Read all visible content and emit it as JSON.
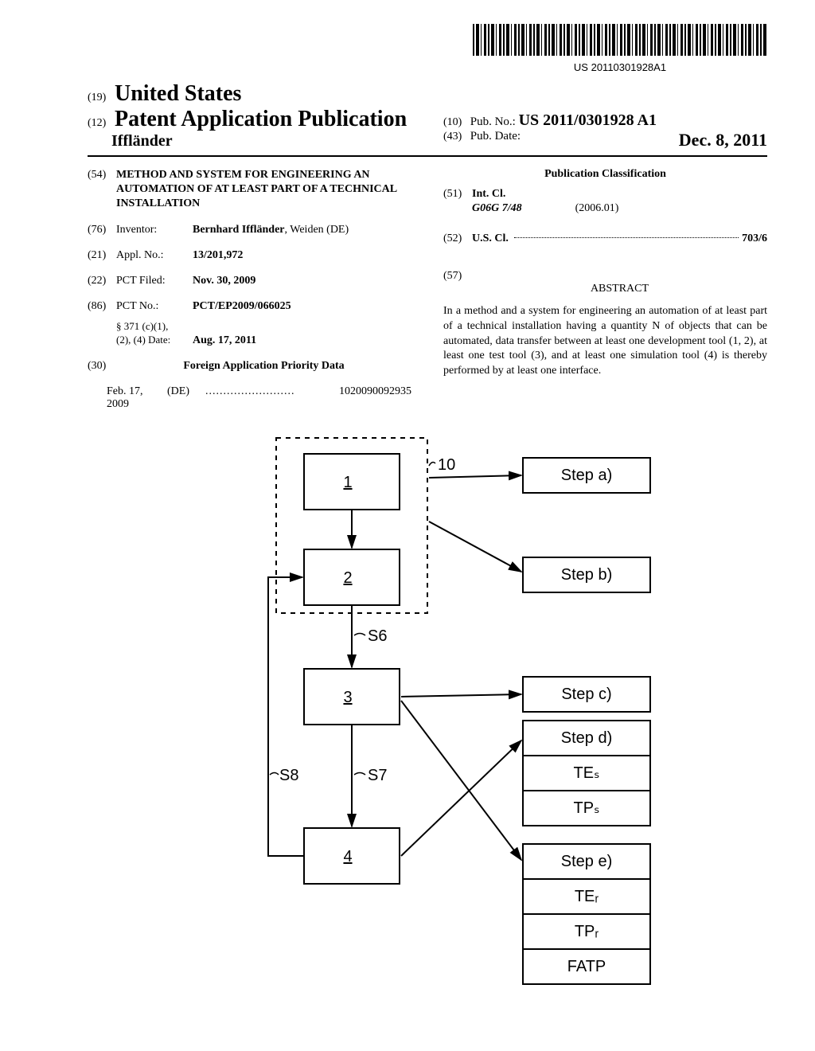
{
  "barcode_text": "US 20110301928A1",
  "header": {
    "code19": "(19)",
    "country": "United States",
    "code12": "(12)",
    "pub_type": "Patent Application Publication",
    "author": "Iffländer",
    "code10": "(10)",
    "pub_no_label": "Pub. No.:",
    "pub_no": "US 2011/0301928 A1",
    "code43": "(43)",
    "pub_date_label": "Pub. Date:",
    "pub_date": "Dec. 8, 2011"
  },
  "left": {
    "code54": "(54)",
    "title": "METHOD AND SYSTEM FOR ENGINEERING AN AUTOMATION OF AT LEAST PART OF A TECHNICAL INSTALLATION",
    "code76": "(76)",
    "inventor_label": "Inventor:",
    "inventor_name": "Bernhard Iffländer",
    "inventor_loc": ", Weiden (DE)",
    "code21": "(21)",
    "appl_label": "Appl. No.:",
    "appl_no": "13/201,972",
    "code22": "(22)",
    "pct_filed_label": "PCT Filed:",
    "pct_filed": "Nov. 30, 2009",
    "code86": "(86)",
    "pct_no_label": "PCT No.:",
    "pct_no": "PCT/EP2009/066025",
    "sec371_label1": "§ 371 (c)(1),",
    "sec371_label2": "(2), (4) Date:",
    "sec371_date": "Aug. 17, 2011",
    "code30": "(30)",
    "foreign_heading": "Foreign Application Priority Data",
    "priority_date": "Feb. 17, 2009",
    "priority_cc": "(DE)",
    "priority_dots": ".........................",
    "priority_num": "1020090092935"
  },
  "right": {
    "class_heading": "Publication Classification",
    "code51": "(51)",
    "intcl_label": "Int. Cl.",
    "intcl_code": "G06G 7/48",
    "intcl_date": "(2006.01)",
    "code52": "(52)",
    "uscl_label": "U.S. Cl.",
    "uscl_value": "703/6",
    "code57": "(57)",
    "abstract_heading": "ABSTRACT",
    "abstract_text": "In a method and a system for engineering an automation of at least part of a technical installation having a quantity N of objects that can be automated, data transfer between at least one development tool (1, 2), at least one test tool (3), and at least one simulation tool (4) is thereby performed by at least one interface."
  },
  "figure": {
    "n1": "1",
    "n2": "2",
    "n3": "3",
    "n4": "4",
    "l10": "10",
    "s6": "S6",
    "s7": "S7",
    "s8": "S8",
    "stepA": "Step a)",
    "stepB": "Step b)",
    "stepC": "Step c)",
    "stepD": "Step d)",
    "stepE": "Step e)",
    "tes": "TEₛ",
    "tps": "TPₛ",
    "ter": "TEᵣ",
    "tpr": "TPᵣ",
    "fatp": "FATP"
  }
}
